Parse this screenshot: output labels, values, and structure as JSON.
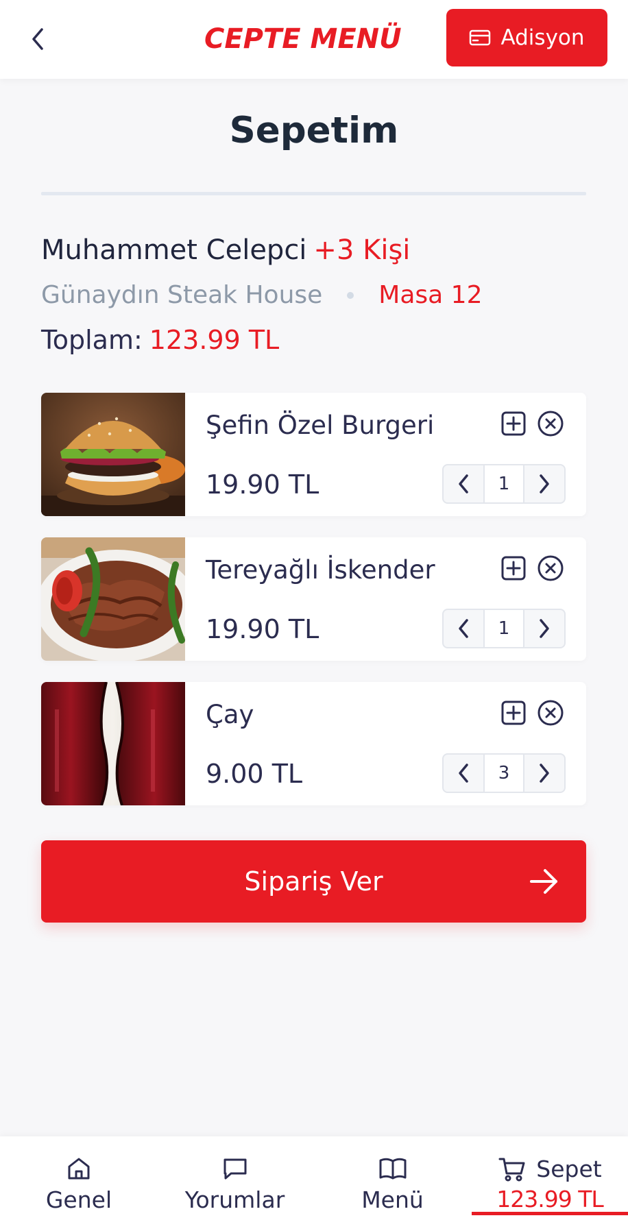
{
  "header": {
    "logo": "CEPTE MENÜ",
    "adisyon_label": "Adisyon"
  },
  "page_title": "Sepetim",
  "info": {
    "customer_name": "Muhammet Celepci",
    "extra_people": "+3 Kişi",
    "restaurant": "Günaydın Steak House",
    "table": "Masa 12",
    "total_label": "Toplam:",
    "total_amount": "123.99 TL"
  },
  "items": [
    {
      "name": "Şefin Özel Burgeri",
      "price": "19.90 TL",
      "qty": "1"
    },
    {
      "name": "Tereyağlı İskender",
      "price": "19.90 TL",
      "qty": "1"
    },
    {
      "name": "Çay",
      "price": "9.00 TL",
      "qty": "3"
    }
  ],
  "order_button": "Sipariş Ver",
  "nav": {
    "genel": "Genel",
    "yorumlar": "Yorumlar",
    "menu": "Menü",
    "sepet": "Sepet",
    "sepet_amount": "123.99 TL"
  },
  "colors": {
    "accent": "#e81c24",
    "text": "#2b2c4f",
    "muted": "#8d99a8",
    "background": "#f7f7f9"
  }
}
